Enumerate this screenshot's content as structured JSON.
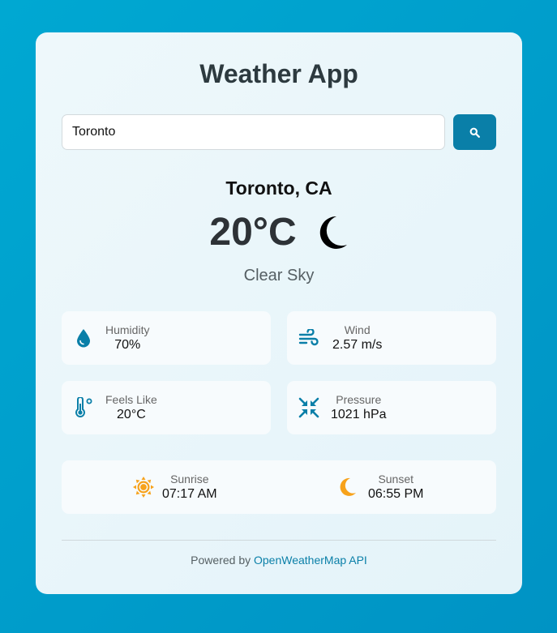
{
  "app": {
    "title": "Weather App"
  },
  "search": {
    "value": "Toronto",
    "button_icon": "search-icon"
  },
  "current": {
    "location": "Toronto, CA",
    "temperature": "20°C",
    "condition_icon": "moon-icon",
    "condition": "Clear Sky"
  },
  "details": [
    {
      "label": "Humidity",
      "value": "70%",
      "icon": "droplet-icon"
    },
    {
      "label": "Wind",
      "value": "2.57 m/s",
      "icon": "wind-icon"
    },
    {
      "label": "Feels Like",
      "value": "20°C",
      "icon": "thermometer-icon"
    },
    {
      "label": "Pressure",
      "value": "1021 hPa",
      "icon": "compress-icon"
    }
  ],
  "sun": {
    "sunrise_label": "Sunrise",
    "sunrise_time": "07:17 AM",
    "sunset_label": "Sunset",
    "sunset_time": "06:55 PM"
  },
  "footer": {
    "text": "Powered by",
    "link_text": "OpenWeatherMap API"
  },
  "colors": {
    "background": "#00a8d2",
    "accent": "#0a7fa8",
    "sun_icon": "#f7a21b"
  }
}
